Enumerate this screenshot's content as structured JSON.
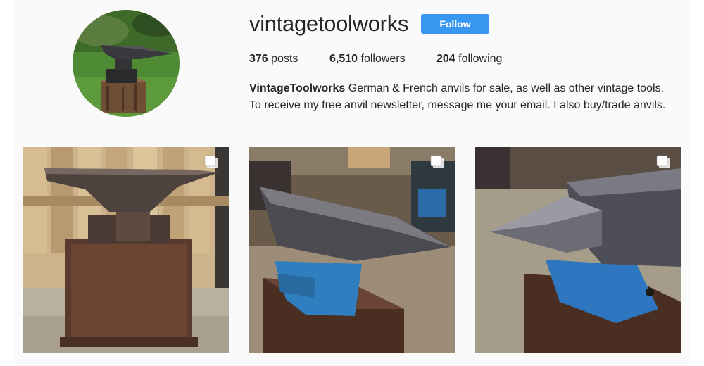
{
  "profile": {
    "username": "vintagetoolworks",
    "follow_label": "Follow",
    "avatar_icon": "anvil-on-stump-photo",
    "accent_color": "#3897f0"
  },
  "stats": {
    "posts_count": "376",
    "posts_label": "posts",
    "followers_count": "6,510",
    "followers_label": "followers",
    "following_count": "204",
    "following_label": "following"
  },
  "bio": {
    "name": "VintageToolworks",
    "text_line1": " German & French anvils for sale, as well as other vintage tools.",
    "text_line2": "To receive my free anvil newsletter, message me your email. I also buy/trade anvils."
  },
  "posts": [
    {
      "subject": "anvil-on-wooden-base-photo",
      "multi_icon": "carousel-icon"
    },
    {
      "subject": "blue-anvil-horn-right-photo",
      "multi_icon": "carousel-icon"
    },
    {
      "subject": "blue-anvil-horn-left-photo",
      "multi_icon": "carousel-icon"
    }
  ]
}
